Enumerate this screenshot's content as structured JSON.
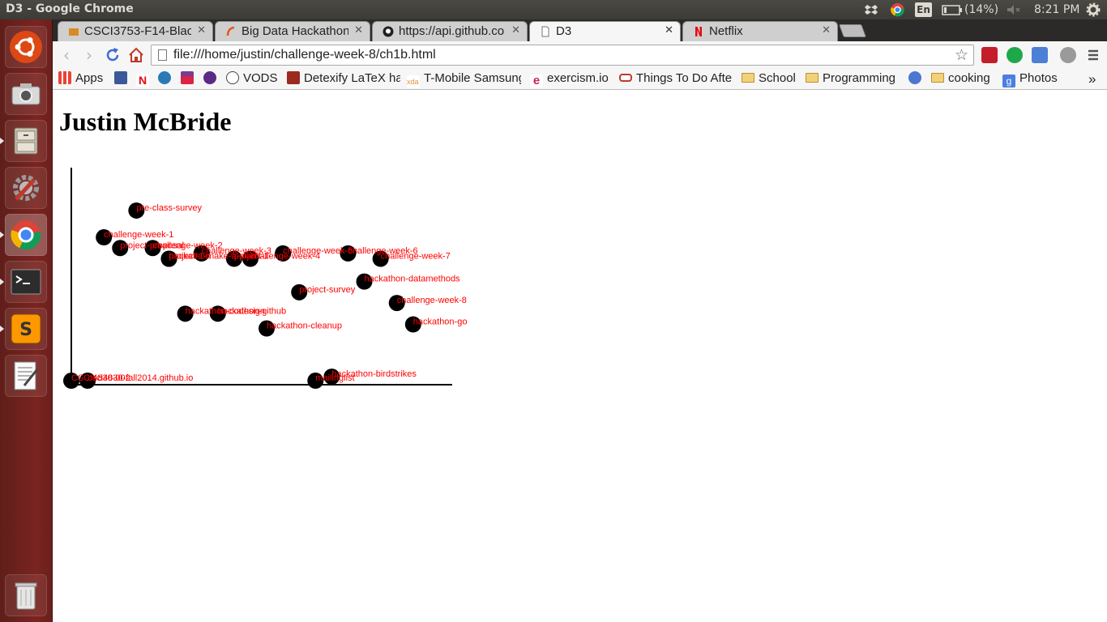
{
  "window": {
    "title": "D3 - Google Chrome"
  },
  "system_tray": {
    "keyboard_layout": "En",
    "battery": "(14%)",
    "clock": "8:21 PM"
  },
  "tabs": [
    {
      "label": "CSCI3753-F14-Blackw",
      "icon": "blackboard-icon",
      "active": false
    },
    {
      "label": "Big Data Hackathon:",
      "icon": "hackathon-icon",
      "active": false
    },
    {
      "label": "https://api.github.co",
      "icon": "github-icon",
      "active": false
    },
    {
      "label": "D3",
      "icon": "page-icon",
      "active": true
    },
    {
      "label": "Netflix",
      "icon": "netflix-icon",
      "active": false
    }
  ],
  "toolbar": {
    "url": "file:///home/justin/challenge-week-8/ch1b.html"
  },
  "bookmarks": [
    {
      "label": "Apps",
      "icon": "apps-grid-icon"
    },
    {
      "label": "",
      "icon": "facebook-icon"
    },
    {
      "label": "",
      "icon": "netflix-icon"
    },
    {
      "label": "",
      "icon": "mint-icon"
    },
    {
      "label": "",
      "icon": "calendar-icon"
    },
    {
      "label": "",
      "icon": "peace-icon"
    },
    {
      "label": "VODS",
      "icon": "reddit-icon"
    },
    {
      "label": "Detexify LaTeX ha",
      "icon": "detexify-icon"
    },
    {
      "label": "T-Mobile Samsung",
      "icon": "xda-icon"
    },
    {
      "label": "exercism.io",
      "icon": "exercism-icon"
    },
    {
      "label": "Things To Do Afte",
      "icon": "glasses-icon"
    },
    {
      "label": "School",
      "icon": "folder-icon"
    },
    {
      "label": "Programming",
      "icon": "folder-icon"
    },
    {
      "label": "",
      "icon": "settings-badge-icon"
    },
    {
      "label": "cooking",
      "icon": "folder-icon"
    },
    {
      "label": "Photos",
      "icon": "google-photos-icon"
    }
  ],
  "bookmarks_overflow": "»",
  "page": {
    "heading": "Justin McBride"
  },
  "chart_data": {
    "type": "scatter",
    "title": "",
    "xlabel": "",
    "ylabel": "",
    "points": [
      {
        "label": "pre-class-survey",
        "x": 2,
        "y": 13
      },
      {
        "label": "challenge-week-1",
        "x": 1,
        "y": 11
      },
      {
        "label": "project-proposal",
        "x": 1.5,
        "y": 10.2
      },
      {
        "label": "challenge-week-2",
        "x": 2.5,
        "y": 10.2
      },
      {
        "label": "hackathon",
        "x": 3,
        "y": 9.4
      },
      {
        "label": "challenge-week-3",
        "x": 4,
        "y": 9.8
      },
      {
        "label": "project-1-make-a-plan",
        "x": 3,
        "y": 9.4
      },
      {
        "label": "challenge-week-4",
        "x": 5.5,
        "y": 9.4
      },
      {
        "label": "project-1",
        "x": 5,
        "y": 9.4
      },
      {
        "label": "challenge-week-5",
        "x": 6.5,
        "y": 9.8
      },
      {
        "label": "challenge-week-6",
        "x": 8.5,
        "y": 9.8
      },
      {
        "label": "challenge-week-7",
        "x": 9.5,
        "y": 9.4
      },
      {
        "label": "hackathon-datamethods",
        "x": 9,
        "y": 7.7
      },
      {
        "label": "project-survey",
        "x": 7,
        "y": 6.9
      },
      {
        "label": "challenge-week-8",
        "x": 10,
        "y": 6.1
      },
      {
        "label": "hackathon-codesign",
        "x": 3.5,
        "y": 5.3
      },
      {
        "label": "hackathon-github",
        "x": 4.5,
        "y": 5.3
      },
      {
        "label": "hackathon-cleanup",
        "x": 6,
        "y": 4.2
      },
      {
        "label": "hackathon-go",
        "x": 10.5,
        "y": 4.5
      },
      {
        "label": "hackathon-birdstrikes",
        "x": 8,
        "y": 0.6
      },
      {
        "label": "mailinglist",
        "x": 7.5,
        "y": 0.3
      },
      {
        "label": "CSCI4830-002",
        "x": 0,
        "y": 0.3
      },
      {
        "label": "csci4830-fall2014.github.io",
        "x": 0.5,
        "y": 0.3
      }
    ],
    "xlim": [
      0,
      11.7
    ],
    "ylim": [
      0,
      16.2
    ],
    "point_color": "#000000",
    "label_color": "#ff0000",
    "axis_color": "#000000",
    "grid": false,
    "legend": "none"
  }
}
